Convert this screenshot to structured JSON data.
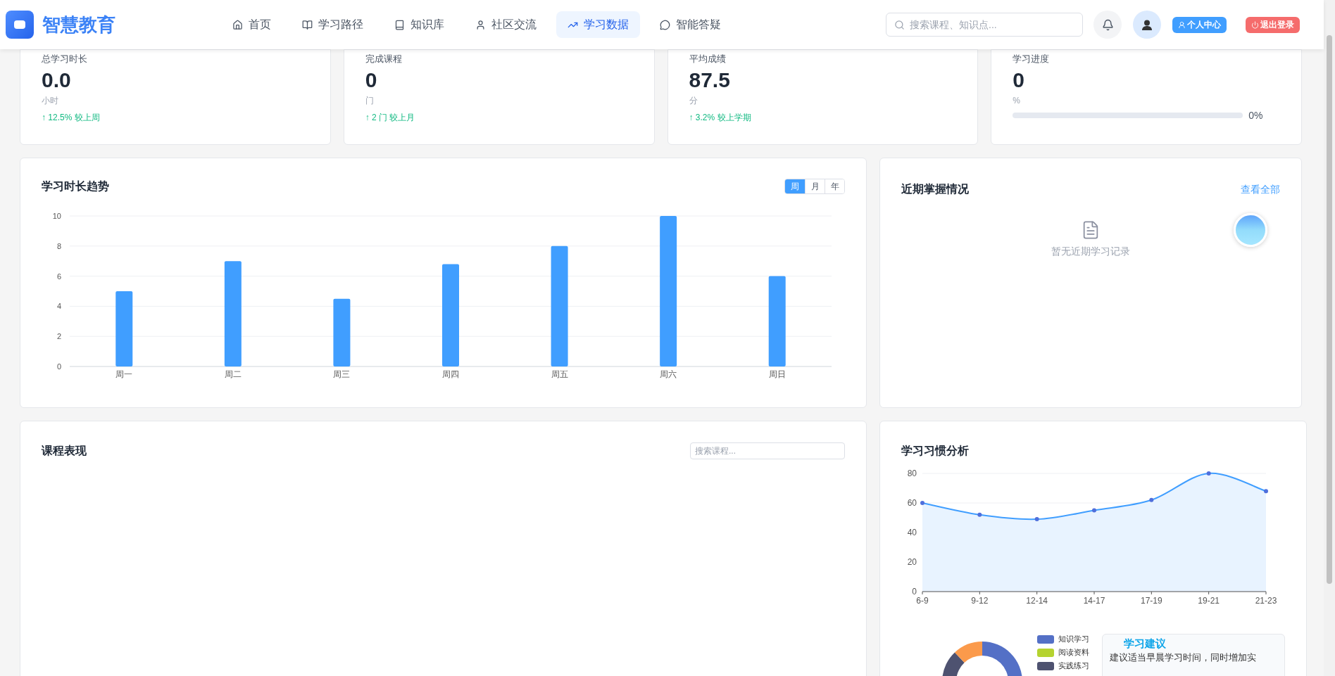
{
  "header": {
    "logo": "智慧教育",
    "nav": [
      {
        "label": "首页",
        "selected": false
      },
      {
        "label": "学习路径",
        "selected": false
      },
      {
        "label": "知识库",
        "selected": false
      },
      {
        "label": "社区交流",
        "selected": false
      },
      {
        "label": "学习数据",
        "selected": true
      },
      {
        "label": "智能答疑",
        "selected": false
      }
    ],
    "search": {
      "placeholder": "搜索课程、知识点..."
    },
    "profile_button": "个人中心",
    "logout_button": "退出登录"
  },
  "stats": [
    {
      "kind": "stat",
      "label": "总学习时长",
      "value": "0.0",
      "unit": "小时",
      "change": "↑ 12.5% 较上周"
    },
    {
      "kind": "stat",
      "label": "完成课程",
      "value": "0",
      "unit": "门",
      "change": "↑ 2 门 较上月"
    },
    {
      "kind": "stat",
      "label": "平均成绩",
      "value": "87.5",
      "unit": "分",
      "change": "↑ 3.2% 较上学期"
    },
    {
      "kind": "progress",
      "label": "学习进度",
      "value": "0",
      "unit": "%",
      "level": 0,
      "reading": "0%"
    }
  ],
  "trend": {
    "title": "学习时长趋势",
    "ranges": [
      {
        "label": "周",
        "selected": true
      },
      {
        "label": "月",
        "selected": false
      },
      {
        "label": "年",
        "selected": false
      }
    ],
    "chart_data": {
      "type": "bar",
      "categories": [
        "周一",
        "周二",
        "周三",
        "周四",
        "周五",
        "周六",
        "周日"
      ],
      "series": [
        {
          "color": "#409eff",
          "values": [
            5,
            7,
            4.5,
            6.8,
            8,
            10,
            6
          ]
        }
      ],
      "ylim": [
        0,
        10
      ],
      "yticks": [
        0,
        2,
        4,
        6,
        8,
        10
      ],
      "grid": true
    }
  },
  "mastery": {
    "title": "近期掌握情况",
    "link": "查看全部",
    "empty": "暂无近期学习记录"
  },
  "courses": {
    "title": "课程表现",
    "search": {
      "placeholder": "搜索课程..."
    }
  },
  "habits": {
    "title": "学习习惯分析",
    "chart_data": {
      "type": "area",
      "categories": [
        "6-9",
        "9-12",
        "12-14",
        "14-17",
        "17-19",
        "19-21",
        "21-23"
      ],
      "series": [
        {
          "color": "#409eff",
          "values": [
            60,
            52,
            49,
            55,
            62,
            80,
            68
          ]
        }
      ],
      "ylim": [
        0,
        80
      ],
      "yticks": [
        0,
        20,
        40,
        60,
        80
      ],
      "grid": true
    },
    "legend": [
      {
        "label": "知识学习",
        "color": "#5470c6"
      },
      {
        "label": "阅读资料",
        "color": "#b5d330"
      },
      {
        "label": "实践练习",
        "color": "#4e5270"
      }
    ],
    "advice": {
      "title": "学习建议",
      "text": "建议适当早晨学习时间，同时增加实"
    }
  }
}
